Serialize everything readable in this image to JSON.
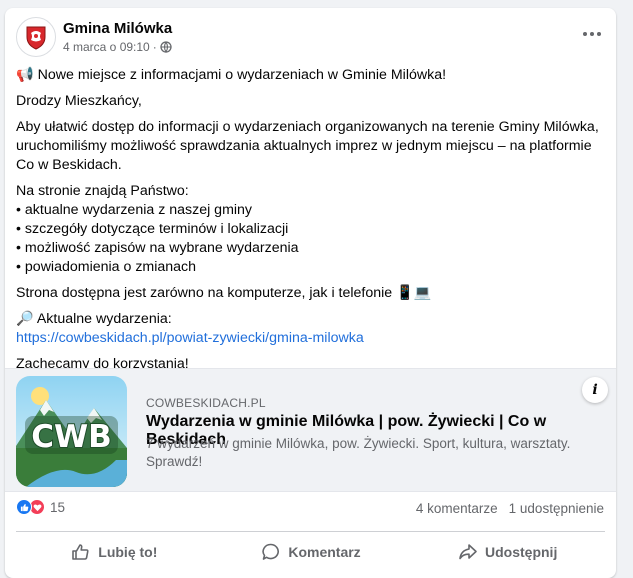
{
  "post": {
    "page_name": "Gmina Milówka",
    "date": "4 marca o 09:10",
    "separator": "·",
    "more_icon": "more-horizontal-icon",
    "audience_icon": "globe-icon"
  },
  "body": {
    "headline_icon": "📢",
    "headline": "Nowe miejsce z informacjami o wydarzeniach w Gminie Milówka!",
    "greeting": "Drodzy Mieszkańcy,",
    "intro": "Aby ułatwić dostęp do informacji o wydarzeniach organizowanych na terenie Gminy Milówka, uruchomiliśmy możliwość sprawdzania aktualnych imprez w jednym miejscu – na platformie Co w Beskidach.",
    "list_heading": "Na stronie znajdą Państwo:",
    "list_items": [
      "• aktualne wydarzenia z naszej gminy",
      "• szczegóły dotyczące terminów i lokalizacji",
      "• możliwość zapisów na wybrane wydarzenia",
      "• powiadomienia o zmianach"
    ],
    "devices_text": "Strona dostępna jest zarówno na komputerze, jak i telefonie",
    "devices_emoji": "📱💻",
    "link_label_icon": "🔎",
    "link_label": "Aktualne wydarzenia:",
    "link_url": "https://cowbeskidach.pl/powiat-zywiecki/gmina-milowka",
    "closing": "Zachęcamy do korzystania!"
  },
  "link_preview": {
    "logo_text": "CWB",
    "domain": "COWBESKIDACH.PL",
    "title": "Wydarzenia w gminie Milówka | pow. Żywiecki | Co w Beskidach",
    "description": "7 wydarzeń w gminie Milówka, pow. Żywiecki. Sport, kultura, warsztaty. Sprawdź!",
    "info_label": "i"
  },
  "stats": {
    "reaction_count": "15",
    "comments": "4 komentarze",
    "shares": "1 udostępnienie"
  },
  "actions": {
    "like": "Lubię to!",
    "comment": "Komentarz",
    "share": "Udostępnij"
  },
  "colors": {
    "link": "#216fdb",
    "like_blue": "#1877f2",
    "love_red": "#f33e58",
    "secondary_text": "#65676b"
  }
}
